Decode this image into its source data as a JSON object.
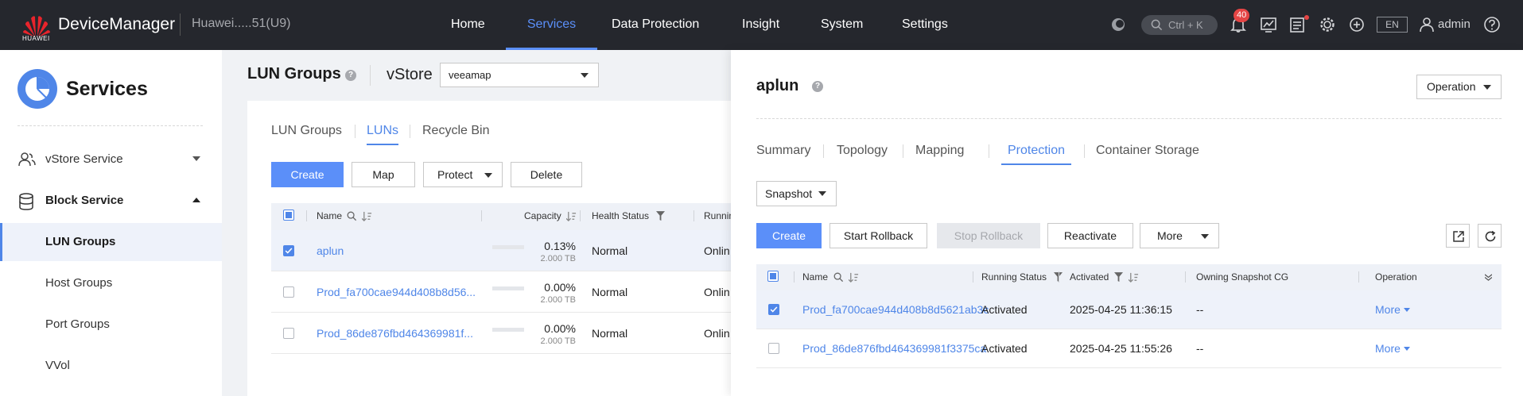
{
  "app": {
    "brand_logo_text": "HUAWEI",
    "name": "DeviceManager",
    "device": "Huawei.....51(U9)"
  },
  "nav": {
    "items": [
      "Home",
      "Services",
      "Data Protection",
      "Insight",
      "System",
      "Settings"
    ],
    "active": "Services"
  },
  "topbar": {
    "search_shortcut": "Ctrl + K",
    "notifications_count": "40",
    "language": "EN",
    "user": "admin"
  },
  "sidebar": {
    "title": "Services",
    "items": [
      {
        "label": "vStore Service",
        "icon": "users-icon",
        "expanded": false
      },
      {
        "label": "Block Service",
        "icon": "database-icon",
        "expanded": true
      },
      {
        "label": "LUN Groups",
        "active": true
      },
      {
        "label": "Host Groups"
      },
      {
        "label": "Port Groups"
      },
      {
        "label": "VVol"
      }
    ]
  },
  "page": {
    "title": "LUN Groups",
    "vstore_label": "vStore",
    "vstore_value": "veeamap"
  },
  "lun_panel": {
    "tabs": [
      "LUN Groups",
      "LUNs",
      "Recycle Bin"
    ],
    "active_tab": "LUNs",
    "buttons": {
      "create": "Create",
      "map": "Map",
      "protect": "Protect",
      "delete": "Delete"
    },
    "columns": {
      "name": "Name",
      "capacity": "Capacity",
      "health": "Health Status",
      "running": "Runnin"
    },
    "rows": [
      {
        "name": "aplun",
        "capacity_pct": "0.13%",
        "capacity_fraction": 0.0013,
        "capacity_total": "2.000 TB",
        "health": "Normal",
        "running": "Onlin",
        "selected": true
      },
      {
        "name": "Prod_fa700cae944d408b8d56...",
        "capacity_pct": "0.00%",
        "capacity_fraction": 0.0,
        "capacity_total": "2.000 TB",
        "health": "Normal",
        "running": "Onlin",
        "selected": false
      },
      {
        "name": "Prod_86de876fbd464369981f...",
        "capacity_pct": "0.00%",
        "capacity_fraction": 0.0,
        "capacity_total": "2.000 TB",
        "health": "Normal",
        "running": "Onlin",
        "selected": false
      }
    ]
  },
  "detail": {
    "title": "aplun",
    "operation_label": "Operation",
    "tabs": [
      "Summary",
      "Topology",
      "Mapping",
      "Protection",
      "Container Storage"
    ],
    "active_tab": "Protection",
    "type_select": "Snapshot",
    "buttons": {
      "create": "Create",
      "start_rollback": "Start Rollback",
      "stop_rollback": "Stop Rollback",
      "reactivate": "Reactivate",
      "more": "More"
    },
    "columns": {
      "name": "Name",
      "running_status": "Running Status",
      "activated": "Activated",
      "owning_cg": "Owning Snapshot CG",
      "operation": "Operation"
    },
    "rows": [
      {
        "name": "Prod_fa700cae944d408b8d5621ab3c",
        "running_status": "Activated",
        "activated": "2025-04-25 11:36:15",
        "owning_cg": "--",
        "operation": "More",
        "selected": true
      },
      {
        "name": "Prod_86de876fbd464369981f3375ca",
        "running_status": "Activated",
        "activated": "2025-04-25 11:55:26",
        "owning_cg": "--",
        "operation": "More",
        "selected": false
      }
    ]
  },
  "colors": {
    "accent": "#4f86e8",
    "topbar": "#25272d",
    "badge": "#e54545"
  }
}
